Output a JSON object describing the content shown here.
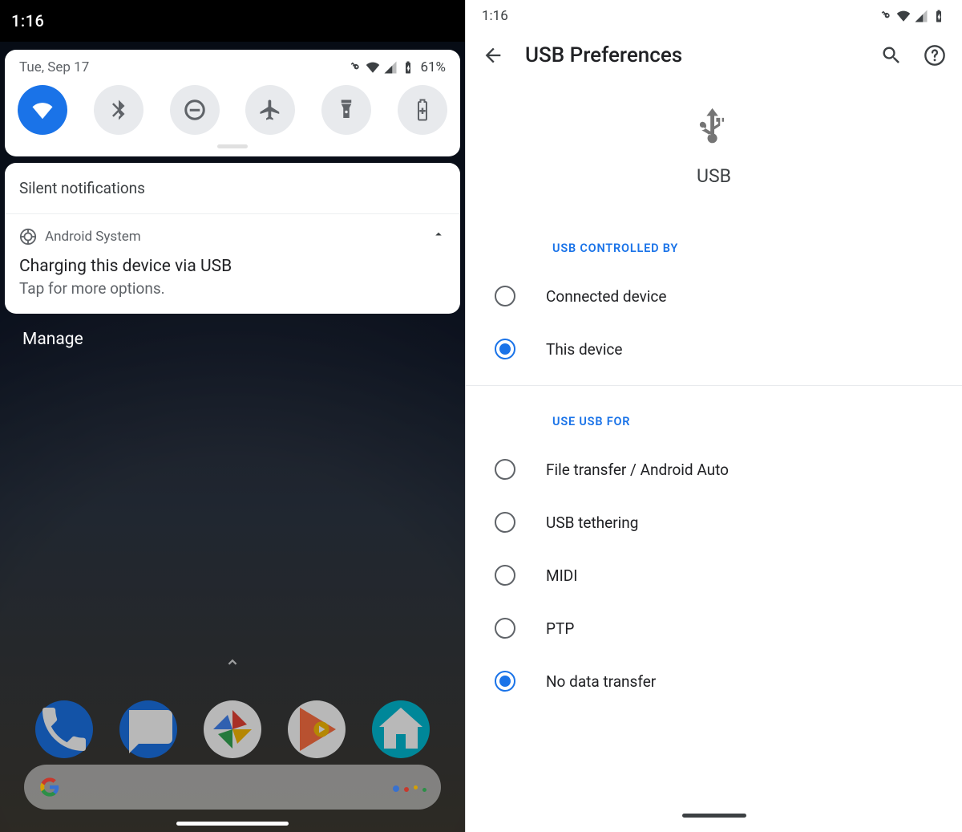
{
  "left": {
    "status_time": "1:16",
    "qs": {
      "date": "Tue, Sep 17",
      "battery": "61%",
      "tiles": [
        {
          "name": "wifi",
          "active": true
        },
        {
          "name": "bluetooth",
          "active": false
        },
        {
          "name": "dnd",
          "active": false
        },
        {
          "name": "airplane",
          "active": false
        },
        {
          "name": "flashlight",
          "active": false
        },
        {
          "name": "battery-saver",
          "active": false
        }
      ]
    },
    "silent_header": "Silent notifications",
    "notification": {
      "source": "Android System",
      "title": "Charging this device via USB",
      "subtitle": "Tap for more options."
    },
    "manage": "Manage",
    "dock_apps": [
      "Phone",
      "Messages",
      "Photos",
      "Play Music",
      "Home"
    ]
  },
  "right": {
    "status_time": "1:16",
    "title": "USB Preferences",
    "hero_label": "USB",
    "section1": "USB CONTROLLED BY",
    "ctrl": [
      {
        "label": "Connected device",
        "checked": false
      },
      {
        "label": "This device",
        "checked": true
      }
    ],
    "section2": "USE USB FOR",
    "use": [
      {
        "label": "File transfer / Android Auto",
        "checked": false
      },
      {
        "label": "USB tethering",
        "checked": false
      },
      {
        "label": "MIDI",
        "checked": false
      },
      {
        "label": "PTP",
        "checked": false
      },
      {
        "label": "No data transfer",
        "checked": true
      }
    ]
  }
}
